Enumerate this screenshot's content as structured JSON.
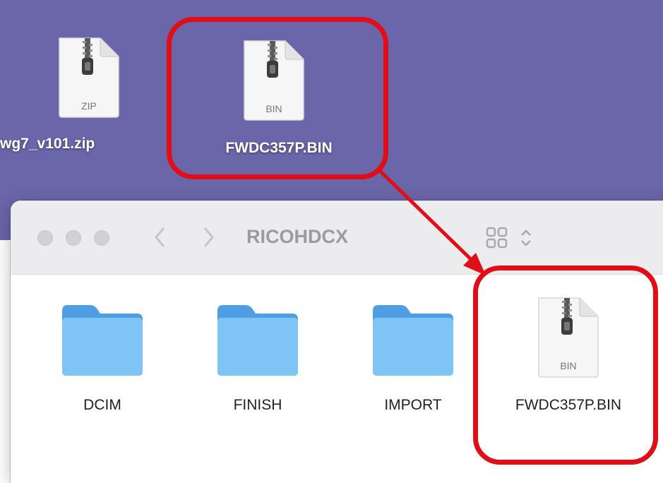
{
  "desktop": {
    "items": [
      {
        "name": "wg7_v101.zip",
        "ext": "ZIP",
        "icon": "zip-archive-icon"
      },
      {
        "name": "FWDC357P.BIN",
        "ext": "BIN",
        "icon": "bin-archive-icon"
      }
    ]
  },
  "window": {
    "title": "RICOHDCX",
    "back_glyph": "〈",
    "forward_glyph": "〉",
    "view_icon": "grid-view-icon",
    "items": [
      {
        "name": "DCIM",
        "kind": "folder"
      },
      {
        "name": "FINISH",
        "kind": "folder"
      },
      {
        "name": "IMPORT",
        "kind": "folder"
      },
      {
        "name": "FWDC357P.BIN",
        "kind": "file",
        "ext": "BIN"
      }
    ]
  },
  "colors": {
    "desktop_bg": "#6b65a9",
    "highlight": "#e10d17",
    "folder": "#7ec4f4"
  }
}
